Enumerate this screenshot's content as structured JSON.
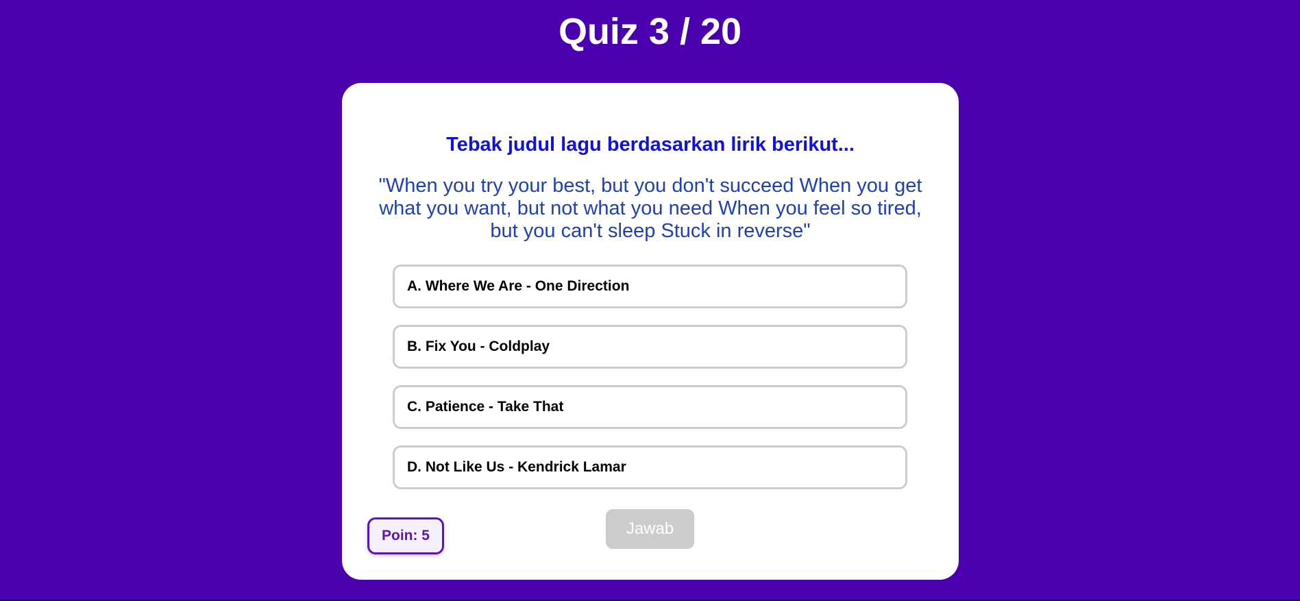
{
  "header": {
    "title": "Quiz 3 / 20"
  },
  "question": {
    "heading": "Tebak judul lagu berdasarkan lirik berikut...",
    "lyric": "\"When you try your best, but you don't succeed When you get what you want, but not what you need When you feel so tired, but you can't sleep Stuck in reverse\""
  },
  "options": [
    {
      "label": "A. Where We Are - One Direction"
    },
    {
      "label": "B. Fix You - Coldplay"
    },
    {
      "label": "C. Patience - Take That"
    },
    {
      "label": "D. Not Like Us - Kendrick Lamar"
    }
  ],
  "score": {
    "label": "Poin: 5"
  },
  "actions": {
    "answer_label": "Jawab"
  },
  "colors": {
    "background": "#4b00b0",
    "card": "#ffffff",
    "heading": "#1010e6",
    "lyric": "#1f3fb8",
    "option_border": "#cccccc",
    "score_accent": "#5a16b0",
    "button_disabled": "#cccccc"
  }
}
